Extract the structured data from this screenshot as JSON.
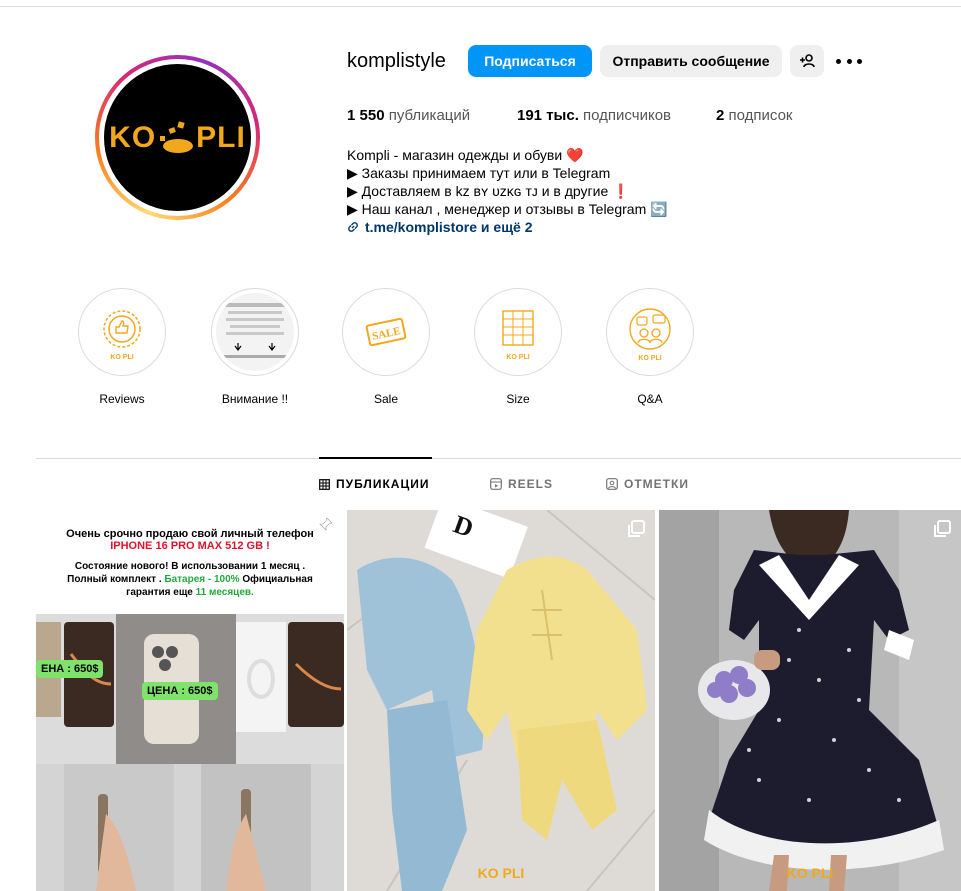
{
  "profile": {
    "username": "komplistyle",
    "avatar_logo": "KO  PLI",
    "follow_label": "Подписаться",
    "message_label": "Отправить сообщение",
    "add_user_icon": "+person-icon",
    "more_icon": "more-icon"
  },
  "stats": {
    "posts_count": "1 550",
    "posts_label": "публикаций",
    "followers_count": "191 тыс.",
    "followers_label": "подписчиков",
    "following_count": "2",
    "following_label": "подписок"
  },
  "bio": {
    "line1": "Kompli - магазин одежды и обуви ❤️",
    "line2": "▶ Заказы принимаем тут или в Telegram",
    "line3": "▶ Доставляем в kz ʙʏ ᴜᴢᴋɢ ᴛᴊ и в другие ❗",
    "line4": "▶ Наш канал , менеджер и отзывы в Telegram 🔄",
    "link": "t.me/komplistore и ещё 2"
  },
  "highlights": [
    {
      "label": "Reviews"
    },
    {
      "label": "Внимание !!"
    },
    {
      "label": "Sale"
    },
    {
      "label": "Size"
    },
    {
      "label": "Q&A"
    }
  ],
  "tabs": {
    "posts": "ПУБЛИКАЦИИ",
    "reels": "REELS",
    "tagged": "ОТМЕТКИ"
  },
  "posts": {
    "p1_title": "Очень срочно продаю свой личный телефон",
    "p1_model": "IPHONE 16 PRO MAX 512 GB !",
    "p1_desc_a": "Состояние нового! В использовании 1 месяц . Полный комплект . ",
    "p1_desc_battery": "Батарея - 100%",
    "p1_desc_b": " Официальная гарантия еще ",
    "p1_desc_months": "11 месяцев.",
    "price_label_1": "ЕНА : 650$",
    "price_label_2": "ЦЕНА : 650$",
    "logo": "KO  PLI"
  },
  "colors": {
    "accent": "#0095f6",
    "brand_gold": "#f2a81d",
    "link": "#00376b"
  }
}
